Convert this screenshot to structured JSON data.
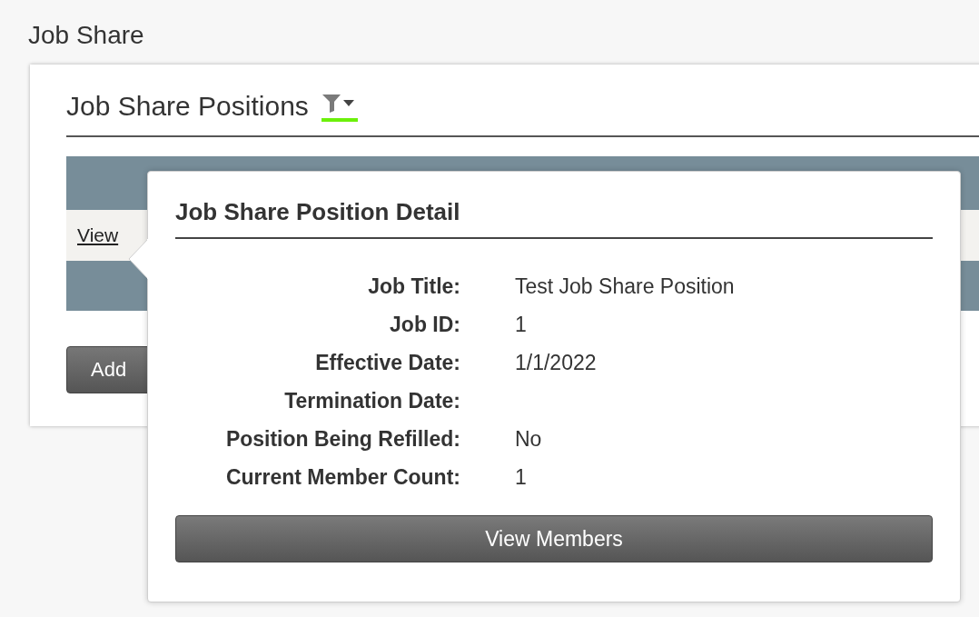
{
  "page_title": "Job Share",
  "panel": {
    "title": "Job Share Positions",
    "rows": [
      {
        "link": "View"
      }
    ],
    "add_button": "Add"
  },
  "popover": {
    "title": "Job Share Position Detail",
    "fields": [
      {
        "label": "Job Title:",
        "value": "Test Job Share Position"
      },
      {
        "label": "Job ID:",
        "value": "1"
      },
      {
        "label": "Effective Date:",
        "value": "1/1/2022"
      },
      {
        "label": "Termination Date:"
      },
      {
        "label": "Position Being Refilled:",
        "value": "No"
      },
      {
        "label": "Current Member Count:",
        "value": "1"
      }
    ],
    "button": "View Members"
  }
}
